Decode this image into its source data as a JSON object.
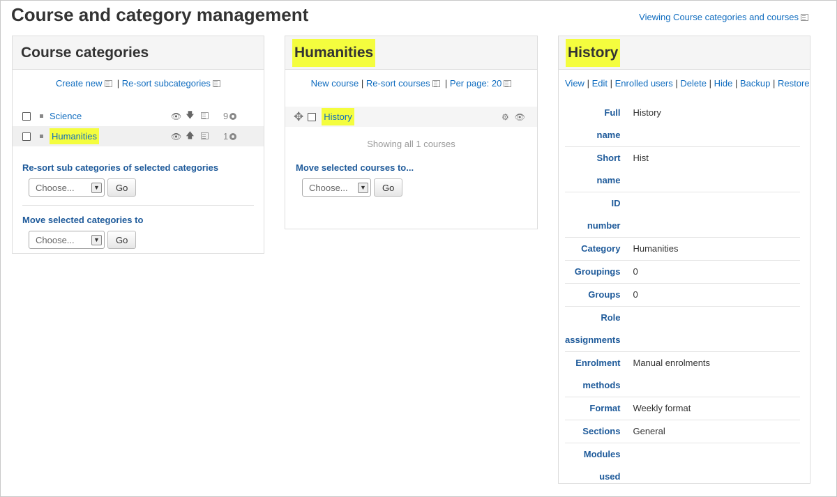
{
  "page": {
    "title": "Course and category management",
    "view_mode": "Viewing Course categories and courses"
  },
  "categories_panel": {
    "title": "Course categories",
    "create_new": "Create new",
    "resort_subcategories": "Re-sort subcategories",
    "categories": [
      {
        "name": "Science",
        "count": "9",
        "move": "down"
      },
      {
        "name": "Humanities",
        "count": "1",
        "move": "up"
      }
    ],
    "resort_title": "Re-sort sub categories of selected categories",
    "move_title": "Move selected categories to",
    "select_placeholder": "Choose...",
    "go_label": "Go"
  },
  "courses_panel": {
    "title": "Humanities",
    "new_course": "New course",
    "resort_courses": "Re-sort courses",
    "per_page": "Per page: 20",
    "courses": [
      {
        "name": "History"
      }
    ],
    "showing": "Showing all 1 courses",
    "move_title": "Move selected courses to...",
    "select_placeholder": "Choose...",
    "go_label": "Go"
  },
  "detail_panel": {
    "title": "History",
    "actions": [
      "View",
      "Edit",
      "Enrolled users",
      "Delete",
      "Hide",
      "Backup",
      "Restore"
    ],
    "rows": [
      {
        "key_line1": "Full",
        "key_line2": "name",
        "value": "History"
      },
      {
        "key_line1": "Short",
        "key_line2": "name",
        "value": "Hist"
      },
      {
        "key_line1": "ID",
        "key_line2": "number",
        "value": ""
      },
      {
        "key_line1": "Category",
        "key_line2": "",
        "value": "Humanities"
      },
      {
        "key_line1": "Groupings",
        "key_line2": "",
        "value": "0"
      },
      {
        "key_line1": "Groups",
        "key_line2": "",
        "value": "0"
      },
      {
        "key_line1": "Role",
        "key_line2": "assignments",
        "value": ""
      },
      {
        "key_line1": "Enrolment",
        "key_line2": "methods",
        "value": "Manual enrolments"
      },
      {
        "key_line1": "Format",
        "key_line2": "",
        "value": "Weekly format"
      },
      {
        "key_line1": "Sections",
        "key_line2": "",
        "value": "General"
      },
      {
        "key_line1": "Modules",
        "key_line2": "used",
        "value": ""
      }
    ]
  },
  "colors": {
    "link": "#0f6cbf",
    "heading_blue": "#1e5a9a",
    "highlight": "#f4fd3e",
    "panel_header_bg": "#f5f5f5"
  }
}
